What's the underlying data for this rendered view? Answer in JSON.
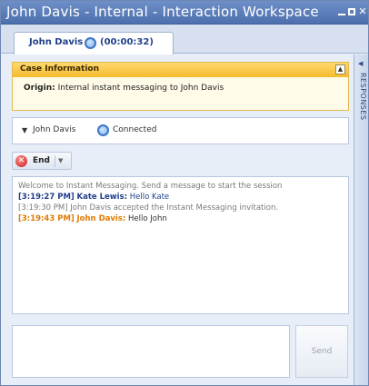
{
  "window": {
    "title": "John Davis - Internal - Interaction Workspace"
  },
  "tab": {
    "label": "John Davis",
    "timer": "(00:00:32)"
  },
  "case": {
    "title": "Case Information",
    "origin_label": "Origin:",
    "origin_value": "Internal instant messaging to John Davis"
  },
  "party": {
    "name": "John Davis",
    "status": "Connected"
  },
  "toolbar": {
    "end_label": "End"
  },
  "transcript": {
    "messages": [
      {
        "type": "system",
        "text": "Welcome to Instant Messaging. Send a message to start the session"
      },
      {
        "type": "agent",
        "time": "[3:19:27 PM]",
        "sender": "Kate Lewis:",
        "text": "Hello Kate"
      },
      {
        "type": "system",
        "text": "[3:19:30 PM] John Davis accepted the Instant Messaging invitation."
      },
      {
        "type": "customer",
        "time": "[3:19:43 PM]",
        "sender": "John Davis:",
        "text": "Hello John"
      }
    ]
  },
  "compose": {
    "value": "",
    "send_label": "Send"
  },
  "sidebar": {
    "label": "RESPONSES"
  },
  "colors": {
    "titlebar": "#5a7cb9",
    "case_header": "#f5bb2c",
    "agent_text": "#1f3f8a",
    "customer_text": "#e07b00",
    "system_text": "#7a7a7a"
  },
  "icons": {
    "status": "connected-status-icon",
    "end": "end-call-icon",
    "minimize": "minimize-icon",
    "maximize": "maximize-icon",
    "close": "close-icon"
  }
}
